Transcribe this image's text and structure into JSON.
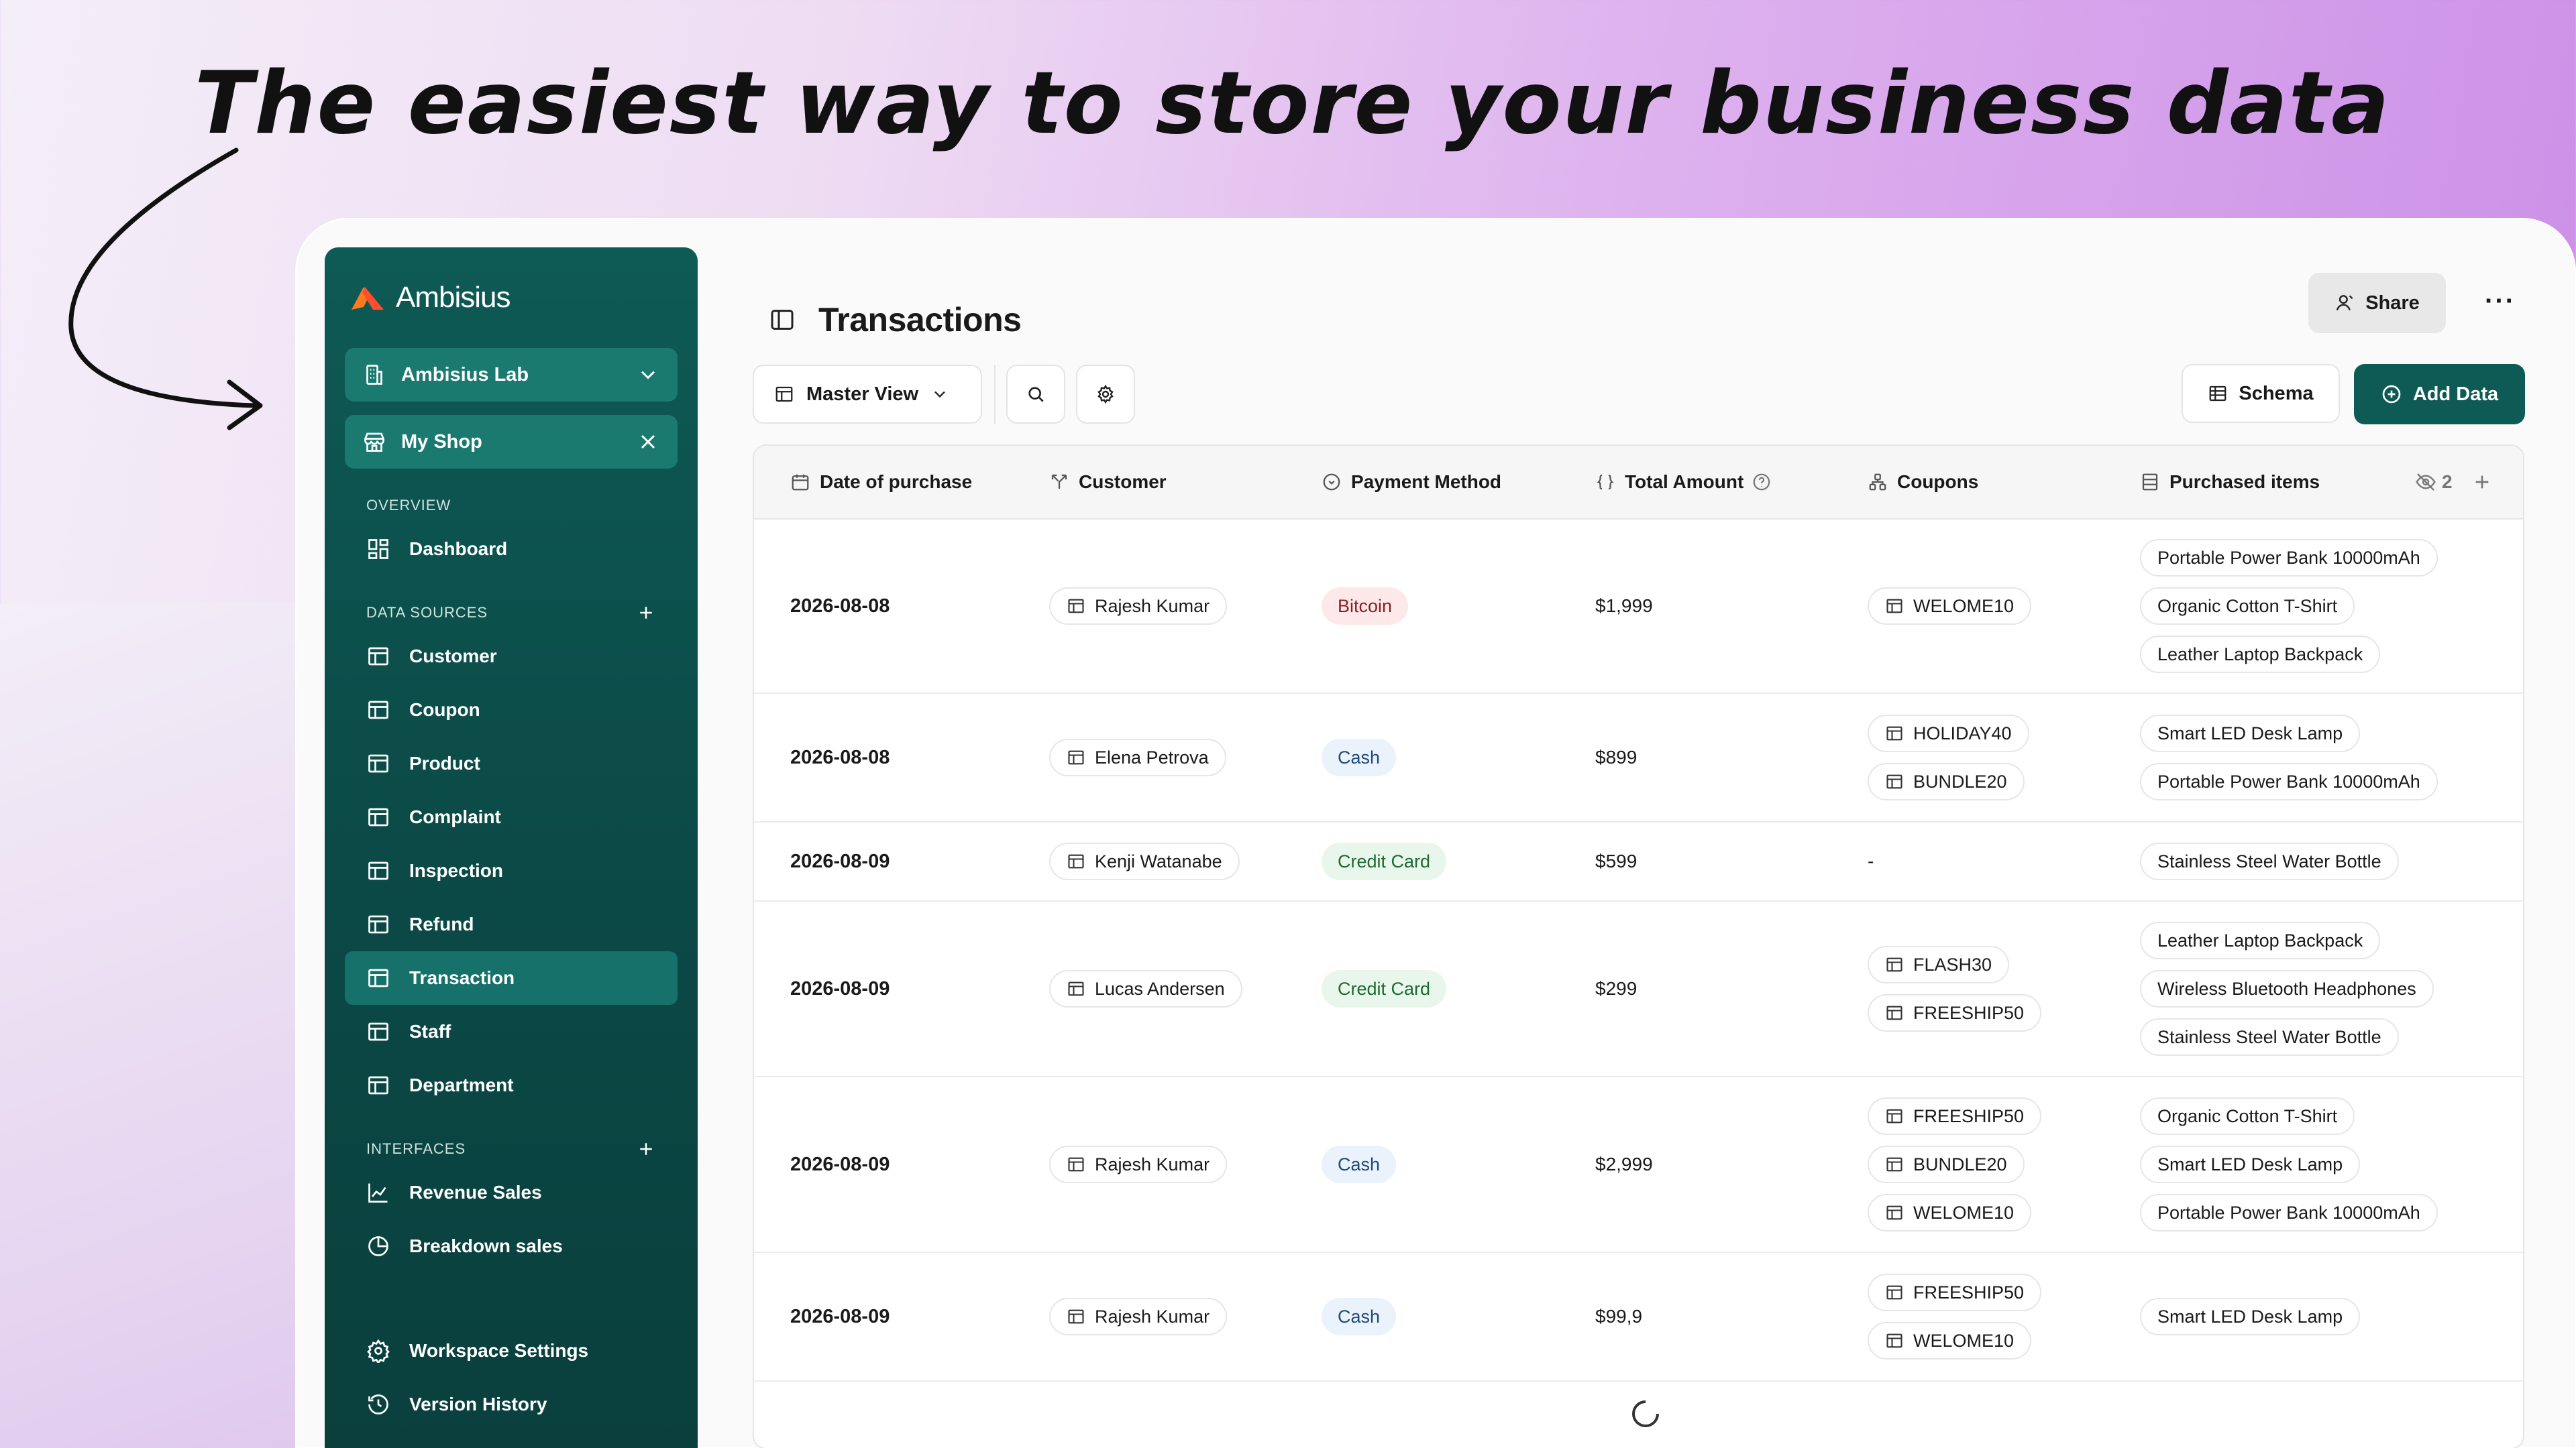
{
  "headline": "The easiest way to store your business data",
  "sidebar": {
    "brand": "Ambisius",
    "workspace": "Ambisius Lab",
    "shop": "My Shop",
    "overview_heading": "OVERVIEW",
    "dashboard": "Dashboard",
    "data_sources_heading": "DATA SOURCES",
    "data_sources": [
      "Customer",
      "Coupon",
      "Product",
      "Complaint",
      "Inspection",
      "Refund",
      "Transaction",
      "Staff",
      "Department"
    ],
    "active": "Transaction",
    "interfaces_heading": "INTERFACES",
    "interfaces": [
      "Revenue Sales",
      "Breakdown sales"
    ],
    "workspace_settings": "Workspace Settings",
    "version_history": "Version History"
  },
  "main": {
    "title": "Transactions",
    "share": "Share",
    "more": "···",
    "view": "Master View",
    "schema": "Schema",
    "add_data": "Add Data"
  },
  "table": {
    "columns": [
      "Date of purchase",
      "Customer",
      "Payment Method",
      "Total Amount",
      "Coupons",
      "Purchased items"
    ],
    "hidden_count": "2",
    "rows": [
      {
        "date": "2026-08-08",
        "customer": "Rajesh Kumar",
        "payment": "Bitcoin",
        "amount": "$1,999",
        "coupons": [
          "WELOME10"
        ],
        "items": [
          "Portable Power Bank 10000mAh",
          "Organic Cotton T-Shirt",
          "Leather Laptop Backpack"
        ]
      },
      {
        "date": "2026-08-08",
        "customer": "Elena Petrova",
        "payment": "Cash",
        "amount": "$899",
        "coupons": [
          "HOLIDAY40",
          "BUNDLE20"
        ],
        "items": [
          "Smart LED Desk Lamp",
          "Portable Power Bank 10000mAh"
        ]
      },
      {
        "date": "2026-08-09",
        "customer": "Kenji Watanabe",
        "payment": "Credit Card",
        "amount": "$599",
        "coupons": [],
        "coupons_empty": "-",
        "items": [
          "Stainless Steel Water Bottle"
        ]
      },
      {
        "date": "2026-08-09",
        "customer": "Lucas Andersen",
        "payment": "Credit Card",
        "amount": "$299",
        "coupons": [
          "FLASH30",
          "FREESHIP50"
        ],
        "items": [
          "Leather Laptop Backpack",
          "Wireless Bluetooth Headphones",
          "Stainless Steel Water Bottle"
        ]
      },
      {
        "date": "2026-08-09",
        "customer": "Rajesh Kumar",
        "payment": "Cash",
        "amount": "$2,999",
        "coupons": [
          "FREESHIP50",
          "BUNDLE20",
          "WELOME10"
        ],
        "items": [
          "Organic Cotton T-Shirt",
          "Smart LED Desk Lamp",
          "Portable Power Bank 10000mAh"
        ]
      },
      {
        "date": "2026-08-09",
        "customer": "Rajesh Kumar",
        "payment": "Cash",
        "amount": "$99,9",
        "coupons": [
          "FREESHIP50",
          "WELOME10"
        ],
        "items": [
          "Smart LED Desk Lamp"
        ]
      }
    ]
  },
  "colors": {
    "sidebar": "#0e5a55",
    "accent": "#0e5a55"
  }
}
